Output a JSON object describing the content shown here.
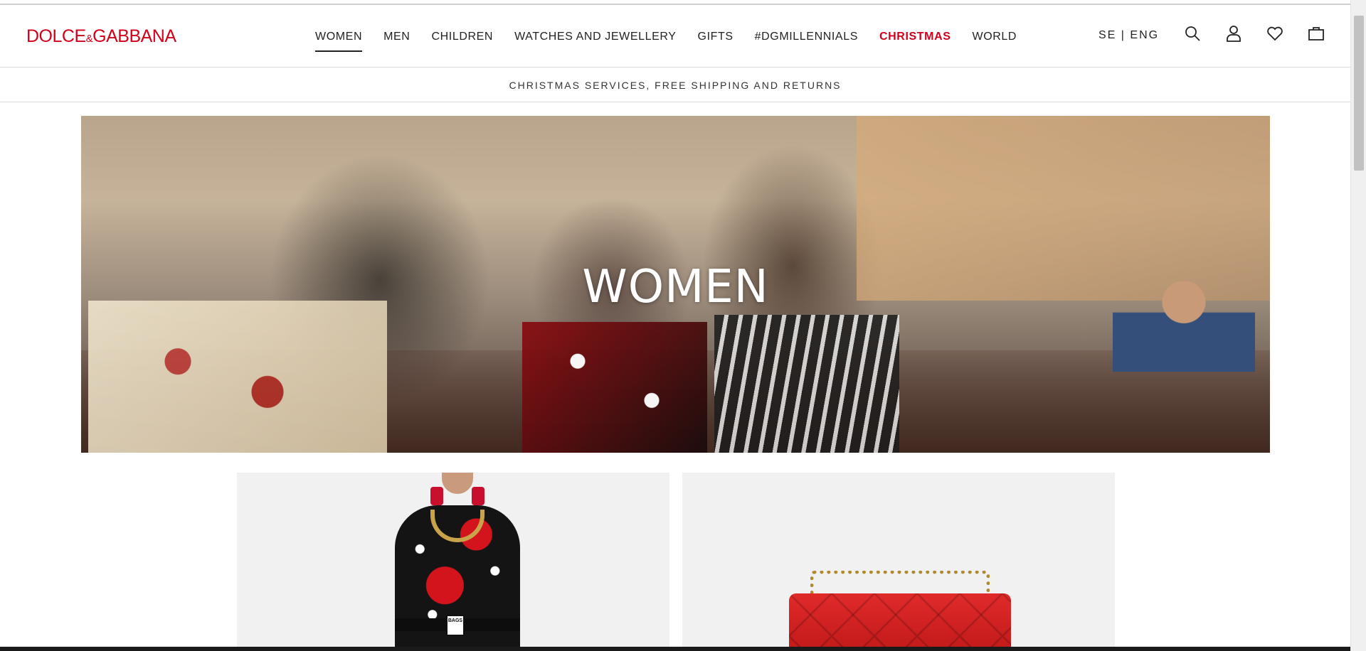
{
  "brand": {
    "logo_main": "DOLCE",
    "logo_amp": "&",
    "logo_second": "GABBANA"
  },
  "nav": {
    "items": [
      {
        "label": "WOMEN",
        "active": true
      },
      {
        "label": "MEN"
      },
      {
        "label": "CHILDREN"
      },
      {
        "label": "WATCHES AND JEWELLERY"
      },
      {
        "label": "GIFTS"
      },
      {
        "label": "#DGMILLENNIALS"
      },
      {
        "label": "CHRISTMAS",
        "highlight_color": "#d0021b"
      },
      {
        "label": "WORLD"
      }
    ]
  },
  "locale": {
    "label": "SE | ENG"
  },
  "header_icons": [
    "search-icon",
    "account-icon",
    "wishlist-heart-icon",
    "shopping-bag-icon"
  ],
  "promo": {
    "text": "CHRISTMAS SERVICES, FREE SHIPPING AND RETURNS"
  },
  "hero": {
    "title": "WOMEN"
  },
  "products": {
    "left": {
      "belt_tag": "BAGS"
    }
  },
  "colors": {
    "brand_red": "#d0021b",
    "text": "#222222",
    "card_bg": "#f1f1f1"
  }
}
